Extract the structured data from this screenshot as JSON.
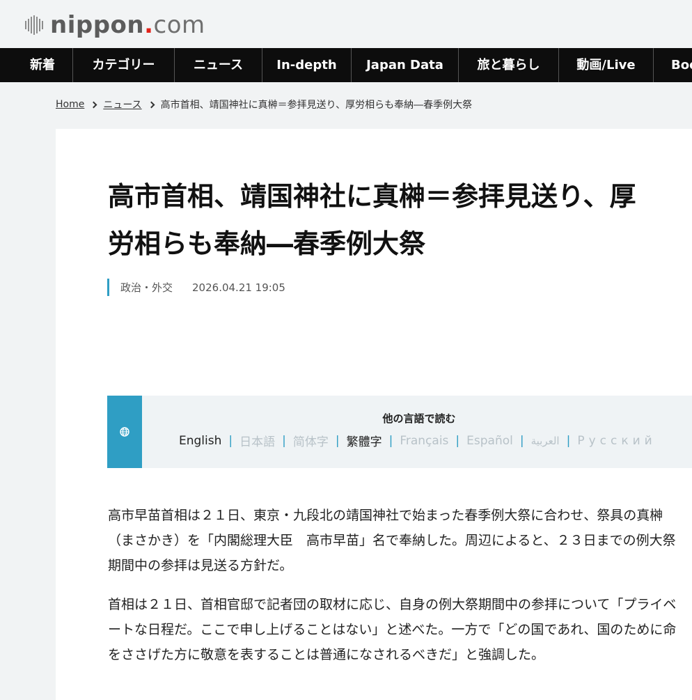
{
  "header": {
    "logo_main": "nippon",
    "logo_dot": ".",
    "logo_com": "com"
  },
  "nav": {
    "items": [
      {
        "label": "新着"
      },
      {
        "label": "カテゴリー"
      },
      {
        "label": "ニュース"
      },
      {
        "label": "In-depth"
      },
      {
        "label": "Japan Data"
      },
      {
        "label": "旅と暮らし"
      },
      {
        "label": "動画/Live"
      },
      {
        "label": "Boo"
      }
    ]
  },
  "breadcrumb": {
    "home": "Home",
    "news": "ニュース",
    "current": "高市首相、靖国神社に真榊＝参拝見送り、厚労相らも奉納―春季例大祭"
  },
  "article": {
    "title": "高市首相、靖国神社に真榊＝参拝見送り、厚労相らも奉納―春季例大祭",
    "category": "政治・外交",
    "date": "2026.04.21 19:05",
    "paragraphs": [
      "高市早苗首相は２１日、東京・九段北の靖国神社で始まった春季例大祭に合わせ、祭具の真榊（まさかき）を「内閣総理大臣　高市早苗」名で奉納した。周辺によると、２３日までの例大祭期間中の参拝は見送る方針だ。",
      "首相は２１日、首相官邸で記者団の取材に応じ、自身の例大祭期間中の参拝について「プライベートな日程だ。ここで申し上げることはない」と述べた。一方で「どの国であれ、国のために命をささげた方に敬意を表することは普通になされるべきだ」と強調した。"
    ]
  },
  "languages": {
    "title": "他の言語で読む",
    "items": [
      {
        "label": "English",
        "active": true
      },
      {
        "label": "日本語",
        "active": false
      },
      {
        "label": "简体字",
        "active": false
      },
      {
        "label": "繁體字",
        "active": true
      },
      {
        "label": "Français",
        "active": false
      },
      {
        "label": "Español",
        "active": false
      },
      {
        "label": "العربية",
        "active": false
      },
      {
        "label": "Русский",
        "active": false
      }
    ]
  },
  "colors": {
    "accent": "#2f9ec4",
    "nav_bg": "#0d0d0d",
    "logo_dot": "#e2231a"
  },
  "icons": {
    "globe": "globe-icon",
    "logo_bars": "logo-bars-icon",
    "chevron": "chevron-right-icon"
  }
}
